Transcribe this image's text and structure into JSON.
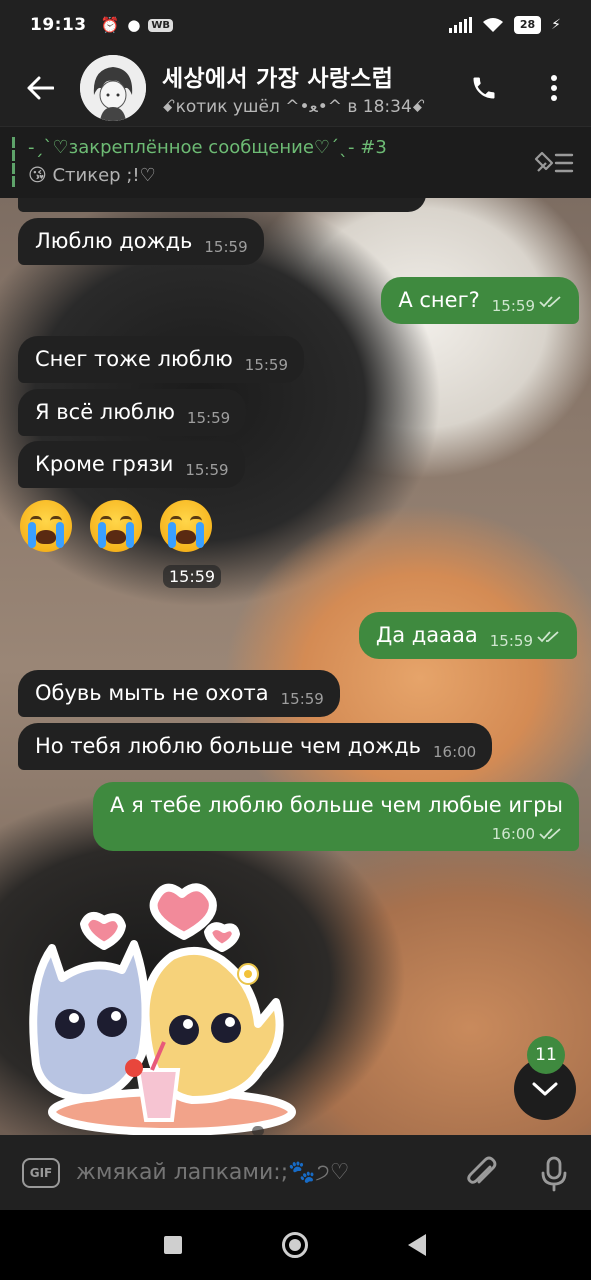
{
  "status": {
    "time": "19:13",
    "wb_label": "WB",
    "battery": "28"
  },
  "header": {
    "title": "세상에서 가장 사랑스럽",
    "subtitle": "ꗃкотик ушёл ^•ﻌ•^ в 18:34ꗃ"
  },
  "pinned": {
    "title": "-ˏˋ♡закреплённое сообщение♡ˊˎ- #3",
    "text": "😘 Стикер ;!♡"
  },
  "messages": [
    {
      "text": "Люблю дождь",
      "time": "15:59",
      "dir": "in"
    },
    {
      "text": "А снег?",
      "time": "15:59",
      "dir": "out"
    },
    {
      "text": "Снег тоже люблю",
      "time": "15:59",
      "dir": "in"
    },
    {
      "text": "Я всё люблю",
      "time": "15:59",
      "dir": "in"
    },
    {
      "text": "Кроме грязи",
      "time": "15:59",
      "dir": "in"
    },
    {
      "text": "Да даааа",
      "time": "15:59",
      "dir": "out"
    },
    {
      "text": "Обувь мыть не охота",
      "time": "15:59",
      "dir": "in"
    },
    {
      "text": "Но тебя люблю больше чем дождь",
      "time": "16:00",
      "dir": "in"
    },
    {
      "text": "А я тебе люблю больше чем любые игры",
      "time": "16:00",
      "dir": "out"
    }
  ],
  "emoji_message": {
    "time": "15:59"
  },
  "unread_count": "11",
  "composer": {
    "gif_label": "GIF",
    "placeholder": "жмякай лапками:;🐾੭♡"
  }
}
